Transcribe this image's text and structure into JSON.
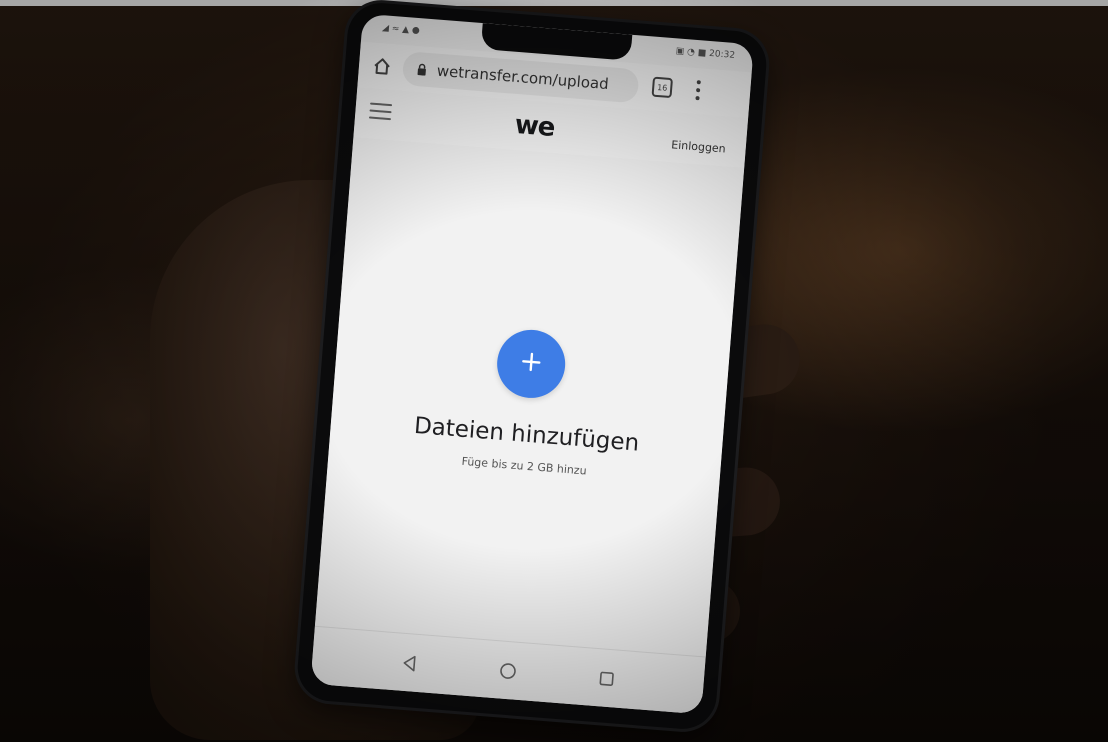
{
  "statusbar": {
    "left": "◢ ≈ ▲ ●",
    "right": "▣ ◔ ■ 20:32"
  },
  "browser": {
    "url": "wetransfer.com/upload",
    "tab_count": "16"
  },
  "site": {
    "logo": "we",
    "login": "Einloggen"
  },
  "upload": {
    "title": "Dateien hinzufügen",
    "subtitle": "Füge bis zu 2 GB hinzu"
  },
  "icons": {
    "home": "home-icon",
    "lock": "lock-icon",
    "menu": "more-vert-icon",
    "hamburger": "hamburger-menu-icon",
    "add": "plus-icon",
    "nav_back": "triangle-back-icon",
    "nav_home": "circle-home-icon",
    "nav_recent": "square-recent-icon"
  },
  "colors": {
    "accent": "#3e7de6",
    "screen_bg": "#f2f2f2",
    "text": "#1f1f22"
  }
}
